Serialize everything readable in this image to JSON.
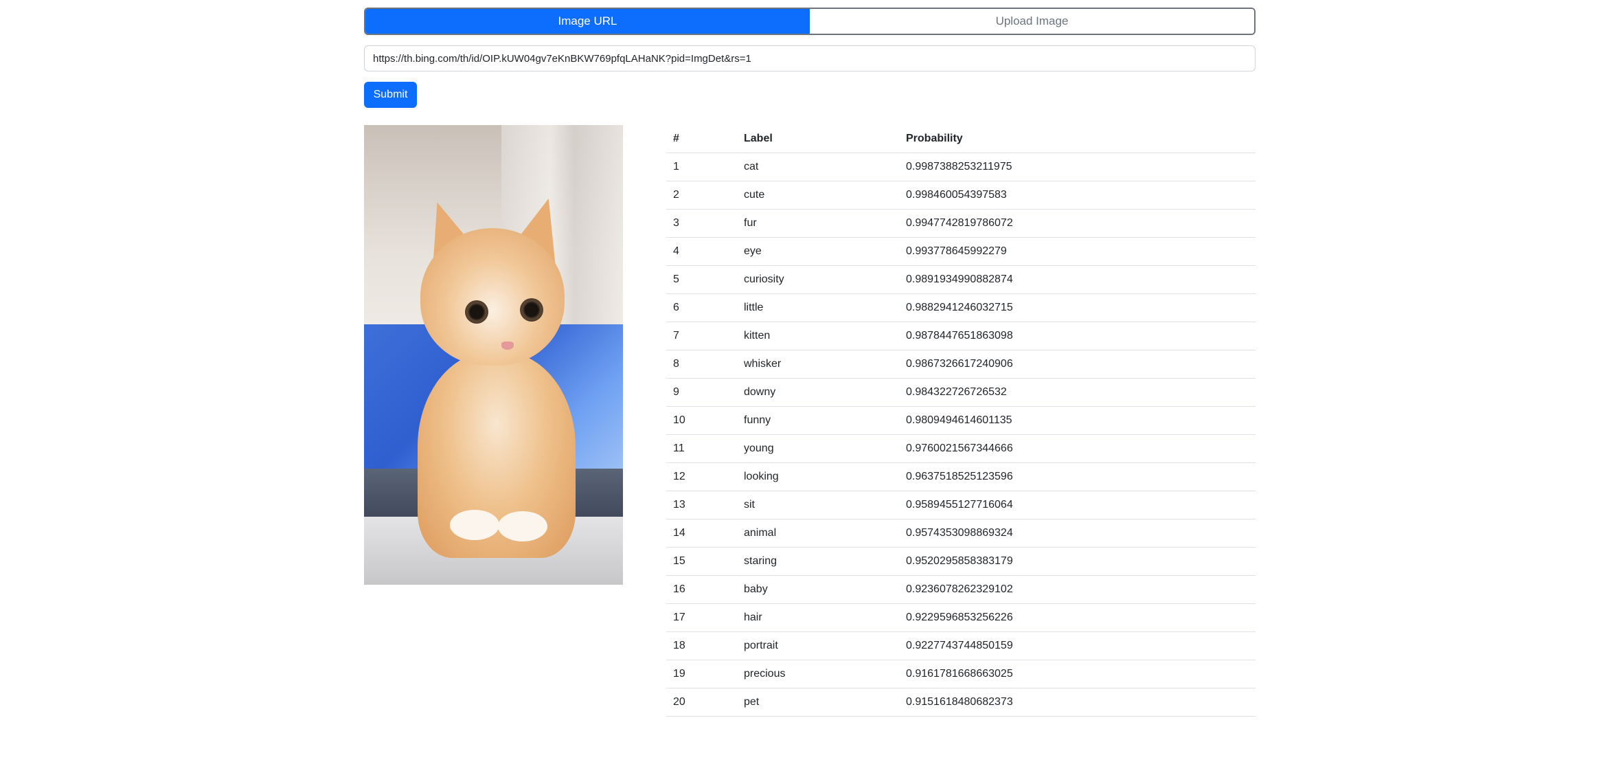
{
  "tabs": [
    {
      "label": "Image URL",
      "active": true
    },
    {
      "label": "Upload Image",
      "active": false
    }
  ],
  "url_input": {
    "value": "https://th.bing.com/th/id/OIP.kUW04gv7eKnBKW769pfqLAHaNK?pid=ImgDet&rs=1"
  },
  "submit_label": "Submit",
  "colors": {
    "primary": "#0d6efd",
    "inactive_text": "#6c757d",
    "border": "#dee2e6"
  },
  "results": {
    "headers": [
      "#",
      "Label",
      "Probability"
    ],
    "rows": [
      {
        "num": "1",
        "label": "cat",
        "prob": "0.9987388253211975"
      },
      {
        "num": "2",
        "label": "cute",
        "prob": "0.998460054397583"
      },
      {
        "num": "3",
        "label": "fur",
        "prob": "0.9947742819786072"
      },
      {
        "num": "4",
        "label": "eye",
        "prob": "0.993778645992279"
      },
      {
        "num": "5",
        "label": "curiosity",
        "prob": "0.9891934990882874"
      },
      {
        "num": "6",
        "label": "little",
        "prob": "0.9882941246032715"
      },
      {
        "num": "7",
        "label": "kitten",
        "prob": "0.9878447651863098"
      },
      {
        "num": "8",
        "label": "whisker",
        "prob": "0.9867326617240906"
      },
      {
        "num": "9",
        "label": "downy",
        "prob": "0.984322726726532"
      },
      {
        "num": "10",
        "label": "funny",
        "prob": "0.9809494614601135"
      },
      {
        "num": "11",
        "label": "young",
        "prob": "0.9760021567344666"
      },
      {
        "num": "12",
        "label": "looking",
        "prob": "0.9637518525123596"
      },
      {
        "num": "13",
        "label": "sit",
        "prob": "0.9589455127716064"
      },
      {
        "num": "14",
        "label": "animal",
        "prob": "0.9574353098869324"
      },
      {
        "num": "15",
        "label": "staring",
        "prob": "0.9520295858383179"
      },
      {
        "num": "16",
        "label": "baby",
        "prob": "0.9236078262329102"
      },
      {
        "num": "17",
        "label": "hair",
        "prob": "0.9229596853256226"
      },
      {
        "num": "18",
        "label": "portrait",
        "prob": "0.9227743744850159"
      },
      {
        "num": "19",
        "label": "precious",
        "prob": "0.9161781668663025"
      },
      {
        "num": "20",
        "label": "pet",
        "prob": "0.9151618480682373"
      }
    ]
  }
}
